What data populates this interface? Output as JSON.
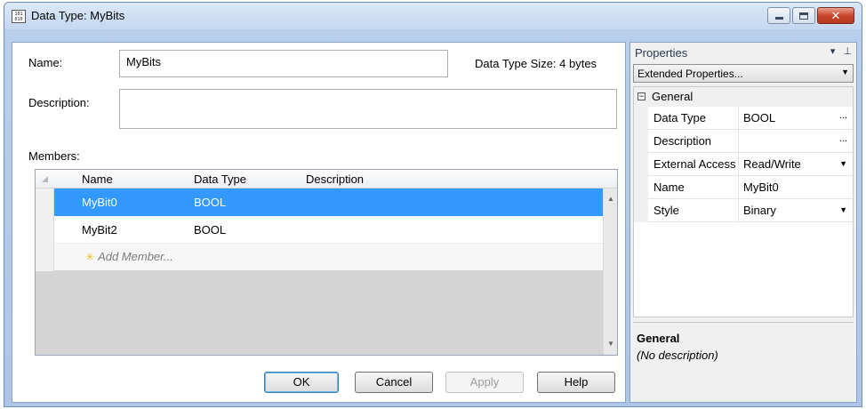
{
  "window": {
    "title": "Data Type: MyBits",
    "icon_text": "101 010"
  },
  "form": {
    "name_label": "Name:",
    "name_value": "MyBits",
    "size_label": "Data Type Size: 4 bytes",
    "description_label": "Description:",
    "description_value": "",
    "members_label": "Members:"
  },
  "members": {
    "columns": [
      "Name",
      "Data Type",
      "Description"
    ],
    "rows": [
      {
        "name": "MyBit0",
        "type": "BOOL",
        "description": "",
        "selected": true
      },
      {
        "name": "MyBit2",
        "type": "BOOL",
        "description": "",
        "selected": false
      }
    ],
    "add_label": "Add Member..."
  },
  "buttons": {
    "ok": "OK",
    "cancel": "Cancel",
    "apply": "Apply",
    "help": "Help"
  },
  "properties": {
    "title": "Properties",
    "combo": "Extended Properties...",
    "category": "General",
    "rows": [
      {
        "key": "Data Type",
        "value": "BOOL",
        "action": "..."
      },
      {
        "key": "Description",
        "value": "",
        "action": "..."
      },
      {
        "key": "External Access",
        "value": "Read/Write",
        "action": "▼"
      },
      {
        "key": "Name",
        "value": "MyBit0",
        "action": ""
      },
      {
        "key": "Style",
        "value": "Binary",
        "action": "▼"
      }
    ],
    "desc_title": "General",
    "desc_text": "(No description)"
  }
}
